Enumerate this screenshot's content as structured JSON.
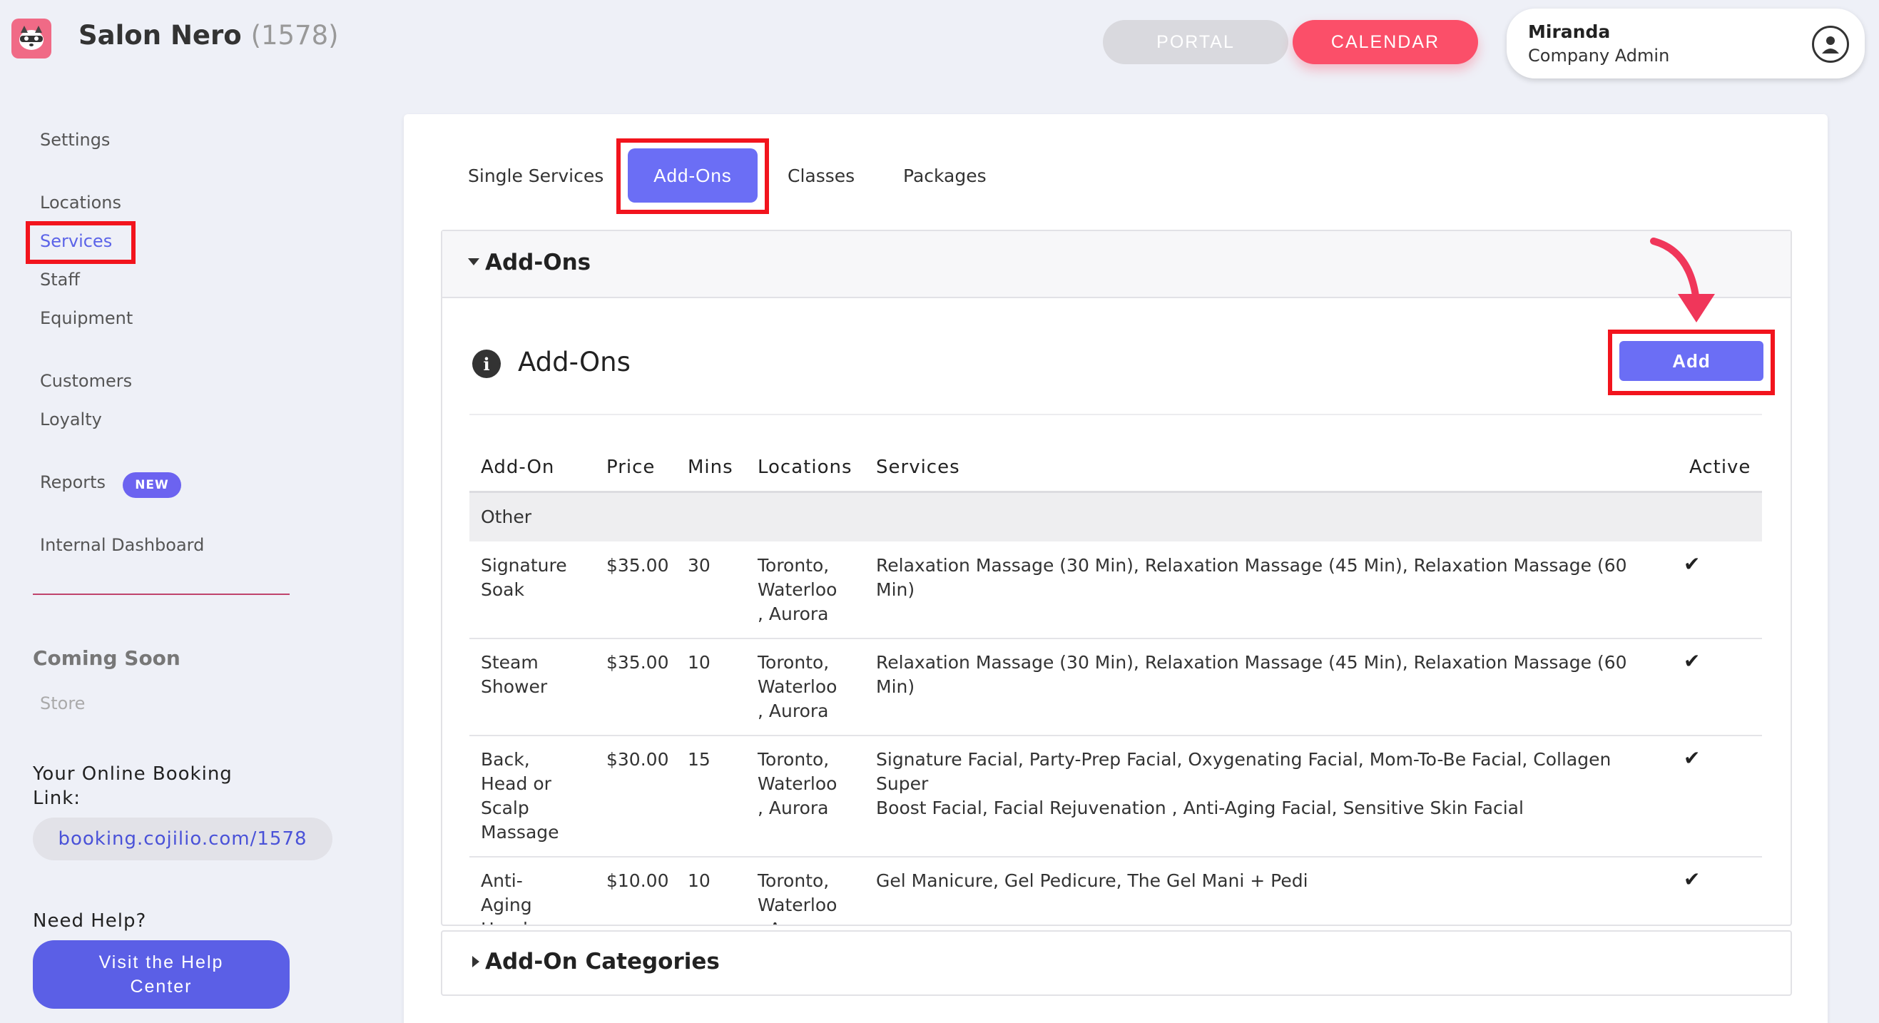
{
  "header": {
    "brand_name": "Salon Nero",
    "brand_number": "(1578)",
    "portal_label": "PORTAL",
    "calendar_label": "CALENDAR",
    "user_name": "Miranda",
    "user_role": "Company Admin"
  },
  "sidebar": {
    "settings": "Settings",
    "locations": "Locations",
    "services": "Services",
    "staff": "Staff",
    "equipment": "Equipment",
    "customers": "Customers",
    "loyalty": "Loyalty",
    "reports": "Reports",
    "reports_badge": "NEW",
    "internal_dashboard": "Internal Dashboard",
    "coming_soon": "Coming Soon",
    "store": "Store",
    "booking_label_1": "Your Online Booking",
    "booking_label_2": "Link:",
    "booking_link": "booking.cojilio.com/1578",
    "need_help": "Need Help?",
    "help_button_1": "Visit the Help",
    "help_button_2": "Center"
  },
  "tabs": {
    "single_services": "Single Services",
    "add_ons": "Add-Ons",
    "classes": "Classes",
    "packages": "Packages"
  },
  "section": {
    "title": "Add-Ons",
    "inner_title": "Add-Ons",
    "add_button": "Add",
    "categories_title": "Add-On Categories"
  },
  "table": {
    "headers": {
      "addon": "Add-On",
      "price": "Price",
      "mins": "Mins",
      "locations": "Locations",
      "services": "Services",
      "active": "Active"
    },
    "group": "Other",
    "rows": [
      {
        "name": [
          "Signature",
          "Soak"
        ],
        "price": "$35.00",
        "mins": "30",
        "locations": [
          "Toronto,",
          "Waterloo",
          ", Aurora"
        ],
        "services": [
          "Relaxation Massage (30 Min), Relaxation Massage (45 Min), Relaxation Massage (60 Min)"
        ],
        "active": "✔"
      },
      {
        "name": [
          "Steam",
          "Shower"
        ],
        "price": "$35.00",
        "mins": "10",
        "locations": [
          "Toronto,",
          "Waterloo",
          ", Aurora"
        ],
        "services": [
          "Relaxation Massage (30 Min), Relaxation Massage (45 Min), Relaxation Massage (60 Min)"
        ],
        "active": "✔"
      },
      {
        "name": [
          "Back,",
          "Head or",
          "Scalp",
          "Massage"
        ],
        "price": "$30.00",
        "mins": "15",
        "locations": [
          "Toronto,",
          "Waterloo",
          ", Aurora"
        ],
        "services": [
          "Signature Facial, Party-Prep Facial, Oxygenating Facial, Mom-To-Be Facial, Collagen Super",
          "Boost Facial, Facial Rejuvenation , Anti-Aging Facial, Sensitive Skin Facial"
        ],
        "active": "✔"
      },
      {
        "name": [
          "Anti-",
          "Aging",
          "Hand"
        ],
        "price": "$10.00",
        "mins": "10",
        "locations": [
          "Toronto,",
          "Waterloo",
          ", Aurora"
        ],
        "services": [
          "Gel Manicure, Gel Pedicure, The Gel Mani + Pedi"
        ],
        "active": "✔"
      }
    ]
  },
  "colors": {
    "accent": "#6b6ef5",
    "calendar": "#fb4f69",
    "highlight": "#f2141d"
  }
}
